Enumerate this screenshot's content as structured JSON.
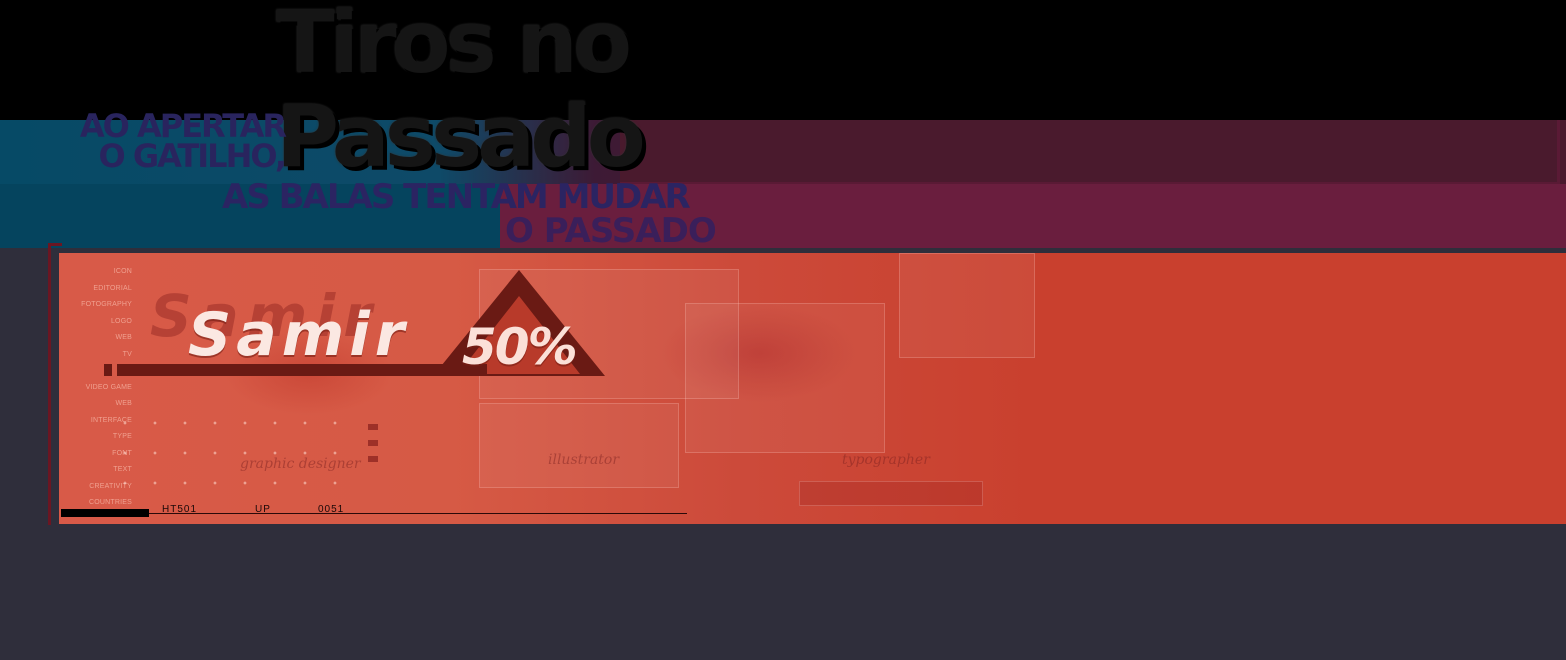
{
  "title": {
    "line1": "Tiros no",
    "line2": "Passado"
  },
  "subtitle": {
    "left_line1": "AO APERTAR",
    "left_line2": "O GATILHO,",
    "main_line1": "AS BALAS TENTAM MUDAR",
    "main_line2": "O PASSADO"
  },
  "side_menu": [
    "ICON",
    "EDITORIAL",
    "FOTOGRAPHY",
    "LOGO",
    "WEB",
    "TV",
    "",
    "VIDEO GAME",
    "WEB",
    "INTERFACE",
    "TYPE",
    "FONT",
    "TEXT",
    "CREATIVITY",
    "COUNTRIES"
  ],
  "player": {
    "name": "Samir",
    "ghost_name": "Samir",
    "percent": "50%"
  },
  "codes": {
    "c1": "HT501",
    "c2": "UP",
    "c3": "0051"
  },
  "art_labels": {
    "l1": "graphic designer",
    "l2": "illustrator",
    "l3": "typographer"
  },
  "colors": {
    "panel": "#c9402e",
    "accent_dark": "#6a1a14",
    "background": "#2f2e3b"
  }
}
